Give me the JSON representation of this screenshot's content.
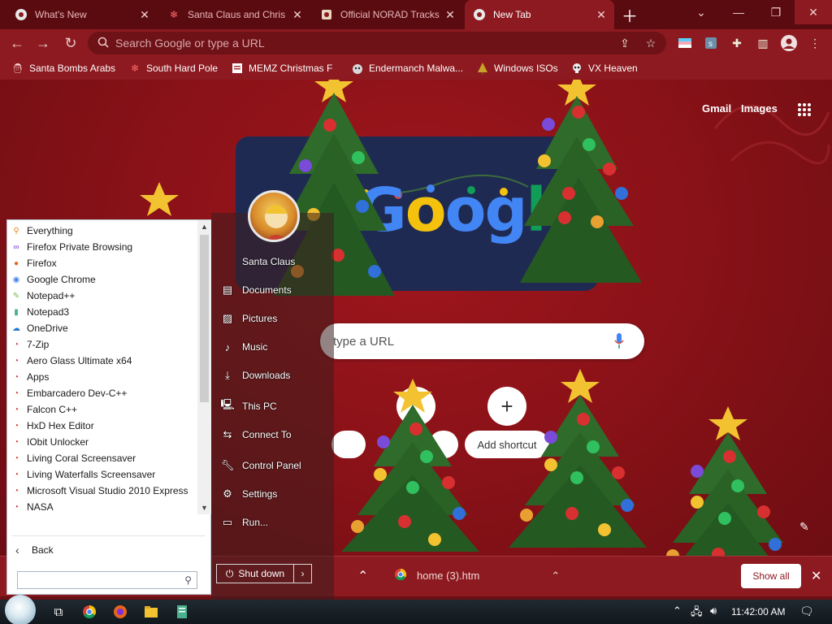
{
  "browser": {
    "tabs": [
      {
        "title": "What's New",
        "icon": "chrome-icon"
      },
      {
        "title": "Santa Claus and Chris",
        "icon": "snowflake-icon"
      },
      {
        "title": "Official NORAD Tracks",
        "icon": "norad-icon"
      },
      {
        "title": "New Tab",
        "icon": "chrome-icon",
        "active": true
      }
    ],
    "omnibox_placeholder": "Search Google or type a URL",
    "bookmarks": [
      {
        "label": "Santa Bombs Arabs",
        "icon": "santa-icon"
      },
      {
        "label": "South Hard Pole",
        "icon": "snowflake-icon"
      },
      {
        "label": "MEMZ Christmas F",
        "icon": "page-icon"
      },
      {
        "label": "Endermanch Malwa...",
        "icon": "wolf-icon"
      },
      {
        "label": "Windows ISOs",
        "icon": "tree-icon"
      },
      {
        "label": "VX Heaven",
        "icon": "skull-icon"
      }
    ],
    "accent": "#8c1a20"
  },
  "newtab": {
    "gmail": "Gmail",
    "images": "Images",
    "search_placeholder": "type a URL",
    "add_shortcut": "Add shortcut",
    "logo": "Google"
  },
  "shelf": {
    "download_name": "home (3).htm",
    "show_all": "Show all"
  },
  "startmenu": {
    "programs": [
      {
        "label": "Everything",
        "icon": "magnifier-icon",
        "color": "#e08a1a"
      },
      {
        "label": "Firefox Private Browsing",
        "icon": "mask-icon",
        "color": "#7b2fd6"
      },
      {
        "label": "Firefox",
        "icon": "firefox-icon",
        "color": "#e8641a"
      },
      {
        "label": "Google Chrome",
        "icon": "chrome-icon",
        "color": "#4285f4"
      },
      {
        "label": "Notepad++",
        "icon": "notepad-icon",
        "color": "#7ab648"
      },
      {
        "label": "Notepad3",
        "icon": "notepad3-icon",
        "color": "#48b08c"
      },
      {
        "label": "OneDrive",
        "icon": "cloud-icon",
        "color": "#1e7ad6"
      },
      {
        "label": "7-Zip",
        "icon": "folder-red-icon",
        "color": "#c8282c"
      },
      {
        "label": "Aero Glass Ultimate x64",
        "icon": "folder-red-icon",
        "color": "#c8282c"
      },
      {
        "label": "Apps",
        "icon": "folder-red-icon",
        "color": "#c8282c"
      },
      {
        "label": "Embarcadero Dev-C++",
        "icon": "folder-red-icon",
        "color": "#c8282c"
      },
      {
        "label": "Falcon C++",
        "icon": "folder-red-icon",
        "color": "#c8282c"
      },
      {
        "label": "HxD Hex Editor",
        "icon": "folder-red-icon",
        "color": "#c8282c"
      },
      {
        "label": "IObit Unlocker",
        "icon": "folder-red-icon",
        "color": "#c8282c"
      },
      {
        "label": "Living Coral Screensaver",
        "icon": "folder-red-icon",
        "color": "#c8282c"
      },
      {
        "label": "Living Waterfalls Screensaver",
        "icon": "folder-red-icon",
        "color": "#c8282c"
      },
      {
        "label": "Microsoft Visual Studio 2010 Express",
        "icon": "folder-red-icon",
        "color": "#c8282c"
      },
      {
        "label": "NASA",
        "icon": "folder-red-icon",
        "color": "#c8282c"
      }
    ],
    "back_label": "Back",
    "right_items": [
      {
        "label": "Santa Claus",
        "icon": "user-icon"
      },
      {
        "label": "Documents",
        "icon": "documents-icon"
      },
      {
        "label": "Pictures",
        "icon": "pictures-icon"
      },
      {
        "label": "Music",
        "icon": "music-icon"
      },
      {
        "label": "Downloads",
        "icon": "download-icon"
      },
      {
        "label": "This PC",
        "icon": "computer-icon"
      },
      {
        "label": "Connect To",
        "icon": "connect-icon"
      },
      {
        "label": "Control Panel",
        "icon": "wrench-icon"
      },
      {
        "label": "Settings",
        "icon": "gear-icon"
      },
      {
        "label": "Run...",
        "icon": "run-icon"
      }
    ],
    "shutdown_label": "Shut down"
  },
  "taskbar": {
    "clock": "11:42:00 AM"
  }
}
